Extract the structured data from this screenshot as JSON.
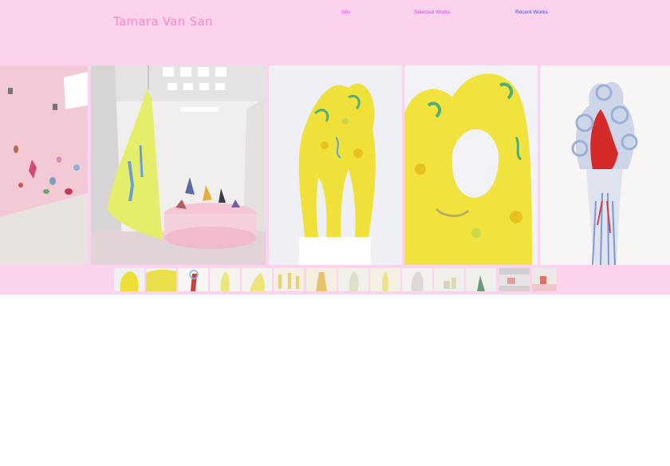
{
  "site": {
    "title": "Tamara Van San"
  },
  "nav": [
    {
      "label": "Info",
      "color": "#d04ad0"
    },
    {
      "label": "Selected Works",
      "color": "#c84ad8"
    },
    {
      "label": "Recent Works",
      "color": "#3a46e0"
    }
  ],
  "colors": {
    "background": "#fbd3ec",
    "title": "#f08ac8"
  },
  "gallery": {
    "panels": [
      {
        "name": "gallery-image-pink-wall-installation"
      },
      {
        "name": "gallery-image-hanging-textile-and-plinth"
      },
      {
        "name": "gallery-image-yellow-sculpture-full"
      },
      {
        "name": "gallery-image-yellow-sculpture-detail"
      },
      {
        "name": "gallery-image-red-loop-sculpture"
      }
    ],
    "thumbnail_count": 14
  }
}
